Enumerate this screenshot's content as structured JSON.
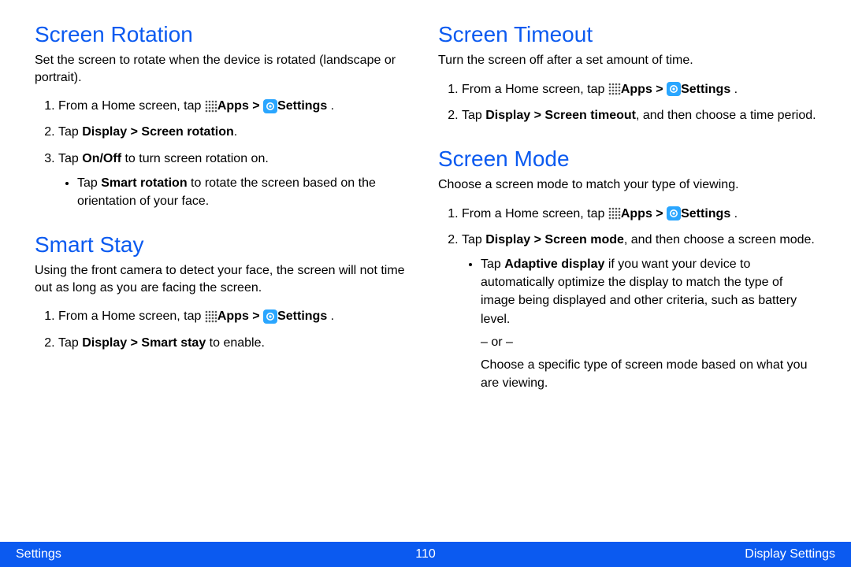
{
  "footer": {
    "left": "Settings",
    "page": "110",
    "right": "Display Settings"
  },
  "labels": {
    "apps": "Apps",
    "settings": "Settings",
    "gt": ">",
    "from_home_tap": "From a Home screen, tap "
  },
  "left_col": {
    "rotation": {
      "heading": "Screen Rotation",
      "intro": "Set the screen to rotate when the device is rotated (landscape or portrait).",
      "step2_prefix": "Tap ",
      "step2_bold": "Display > Screen rotation",
      "step2_suffix": ".",
      "step3_prefix": "Tap ",
      "step3_bold": "On/Off",
      "step3_suffix": " to turn screen rotation on.",
      "bullet_prefix": "Tap ",
      "bullet_bold": "Smart rotation",
      "bullet_suffix": " to rotate the screen based on the orientation of your face."
    },
    "smart_stay": {
      "heading": "Smart Stay",
      "intro": "Using the front camera to detect your face, the screen will not time out as long as you are facing the screen.",
      "step2_prefix": "Tap ",
      "step2_bold": "Display > Smart stay",
      "step2_suffix": " to enable."
    }
  },
  "right_col": {
    "timeout": {
      "heading": "Screen Timeout",
      "intro": "Turn the screen off after a set amount of time.",
      "step2_prefix": "Tap ",
      "step2_bold": "Display > Screen timeout",
      "step2_suffix": ", and then choose a time period."
    },
    "mode": {
      "heading": "Screen Mode",
      "intro": "Choose a screen mode to match your type of viewing.",
      "step2_prefix": "Tap ",
      "step2_bold": "Display > Screen mode",
      "step2_suffix": ", and then choose a screen mode.",
      "bullet_prefix": "Tap ",
      "bullet_bold": "Adaptive display",
      "bullet_suffix": " if you want your device to automatically optimize the display to match the type of image being displayed and other criteria, such as battery level.",
      "or": "– or –",
      "or_after": "Choose a specific type of screen mode based on what you are viewing."
    }
  }
}
